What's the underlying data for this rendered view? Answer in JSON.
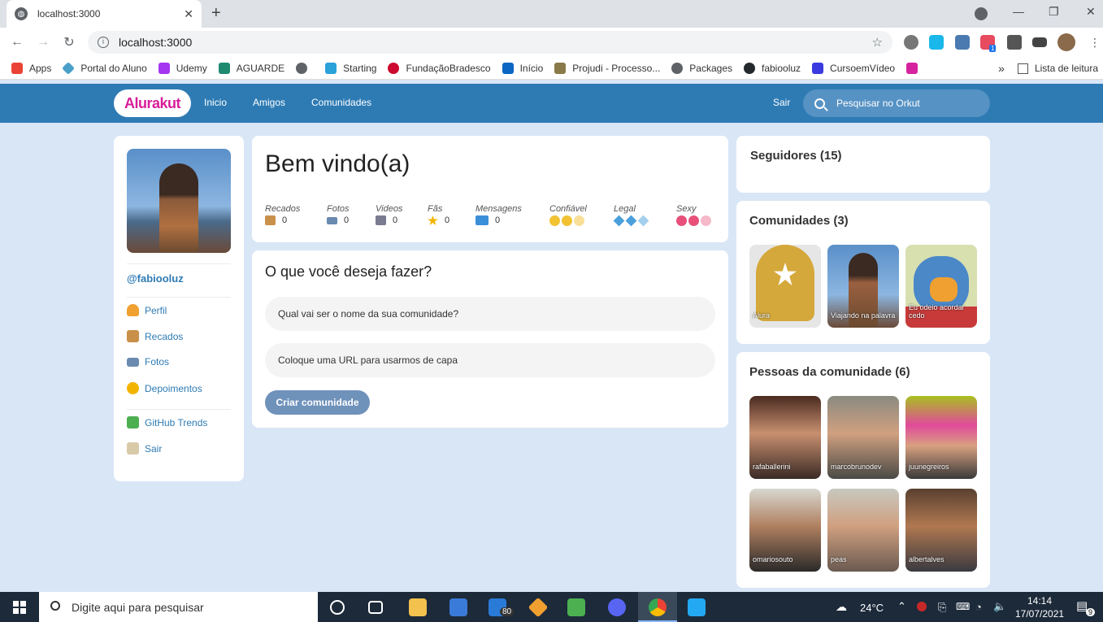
{
  "browser": {
    "tab_title": "localhost:3000",
    "tab_close": "✕",
    "new_tab": "+",
    "url": "localhost:3000",
    "back": "←",
    "forward": "→",
    "reload": "↻",
    "star": "☆",
    "min": "—",
    "max": "❐",
    "close": "✕"
  },
  "bookmarks": [
    {
      "label": "Apps",
      "color": "#ea4335"
    },
    {
      "label": "Portal do Aluno",
      "color": "#4aa0c8"
    },
    {
      "label": "Udemy",
      "color": "#a435f0"
    },
    {
      "label": "AGUARDE",
      "color": "#1f8a70"
    },
    {
      "label": "",
      "color": "#5f6368"
    },
    {
      "label": "Starting",
      "color": "#2aa1d9"
    },
    {
      "label": "FundaçãoBradesco",
      "color": "#cc092f"
    },
    {
      "label": "Início",
      "color": "#0a66c2"
    },
    {
      "label": "Projudi - Processo...",
      "color": "#8a7a4a"
    },
    {
      "label": "Packages",
      "color": "#5f6368"
    },
    {
      "label": "fabiooluz",
      "color": "#24292e"
    },
    {
      "label": "CursoemVídeo",
      "color": "#3a3ae0"
    },
    {
      "label": "",
      "color": "#d6249f"
    }
  ],
  "bookmarks_more": "»",
  "reading_list": "Lista de leitura",
  "header": {
    "logo": "Alurakut",
    "nav": [
      "Inicio",
      "Amigos",
      "Comunidades"
    ],
    "logout": "Sair",
    "search_placeholder": "Pesquisar no Orkut"
  },
  "sidebar": {
    "username": "@fabiooluz",
    "items": [
      {
        "label": "Perfil",
        "icon": "user-icon",
        "color": "#f0a030"
      },
      {
        "label": "Recados",
        "icon": "book-icon",
        "color": "#c9904a"
      },
      {
        "label": "Fotos",
        "icon": "camera-icon",
        "color": "#6a8ab0"
      },
      {
        "label": "Depoimentos",
        "icon": "sun-icon",
        "color": "#f2b400"
      }
    ],
    "items2": [
      {
        "label": "GitHub Trends",
        "icon": "plus-icon",
        "color": "#4caf50"
      },
      {
        "label": "Sair",
        "icon": "home-icon",
        "color": "#d8c9a8"
      }
    ]
  },
  "welcome": {
    "title": "Bem vindo(a)",
    "stats": [
      {
        "label": "Recados",
        "value": "0",
        "icon": "book-icon",
        "color": "#c9904a"
      },
      {
        "label": "Fotos",
        "value": "0",
        "icon": "camera-icon",
        "color": "#6a8ab0"
      },
      {
        "label": "Videos",
        "value": "0",
        "icon": "video-icon",
        "color": "#7a7a90"
      },
      {
        "label": "Fãs",
        "value": "0",
        "icon": "star-icon",
        "color": "#f2b400"
      },
      {
        "label": "Mensagens",
        "value": "0",
        "icon": "mail-icon",
        "color": "#3a8fd8"
      }
    ],
    "ratings": [
      {
        "label": "Confiável",
        "kind": "smile"
      },
      {
        "label": "Legal",
        "kind": "cube"
      },
      {
        "label": "Sexy",
        "kind": "heart"
      }
    ]
  },
  "form": {
    "title": "O que você deseja fazer?",
    "name_placeholder": "Qual vai ser o nome da sua comunidade?",
    "url_placeholder": "Coloque uma URL para usarmos de capa",
    "submit": "Criar comunidade"
  },
  "followers": {
    "title": "Seguidores (15)"
  },
  "communities": {
    "title": "Comunidades (3)",
    "items": [
      {
        "name": "Alura",
        "bg": "#d4a83a"
      },
      {
        "name": "Viajando na palavra",
        "bg": "#6a8fc0"
      },
      {
        "name": "Eu odeio acordar cedo",
        "bg": "#7ab0d0"
      }
    ]
  },
  "people": {
    "title": "Pessoas da comunidade (6)",
    "items": [
      {
        "name": "rafaballerini",
        "bg": "#7a4a40"
      },
      {
        "name": "marcobrunodev",
        "bg": "#6a7060"
      },
      {
        "name": "juunegreiros",
        "bg": "#c04a8a"
      },
      {
        "name": "omariosouto",
        "bg": "#8a8a70"
      },
      {
        "name": "peas",
        "bg": "#9a8a7a"
      },
      {
        "name": "albertalves",
        "bg": "#6a5040"
      }
    ]
  },
  "taskbar": {
    "search_placeholder": "Digite aqui para pesquisar",
    "mail_badge": "80",
    "temperature": "24°C",
    "time": "14:14",
    "date": "17/07/2021",
    "notifications": "9",
    "ext_badge": "1"
  }
}
